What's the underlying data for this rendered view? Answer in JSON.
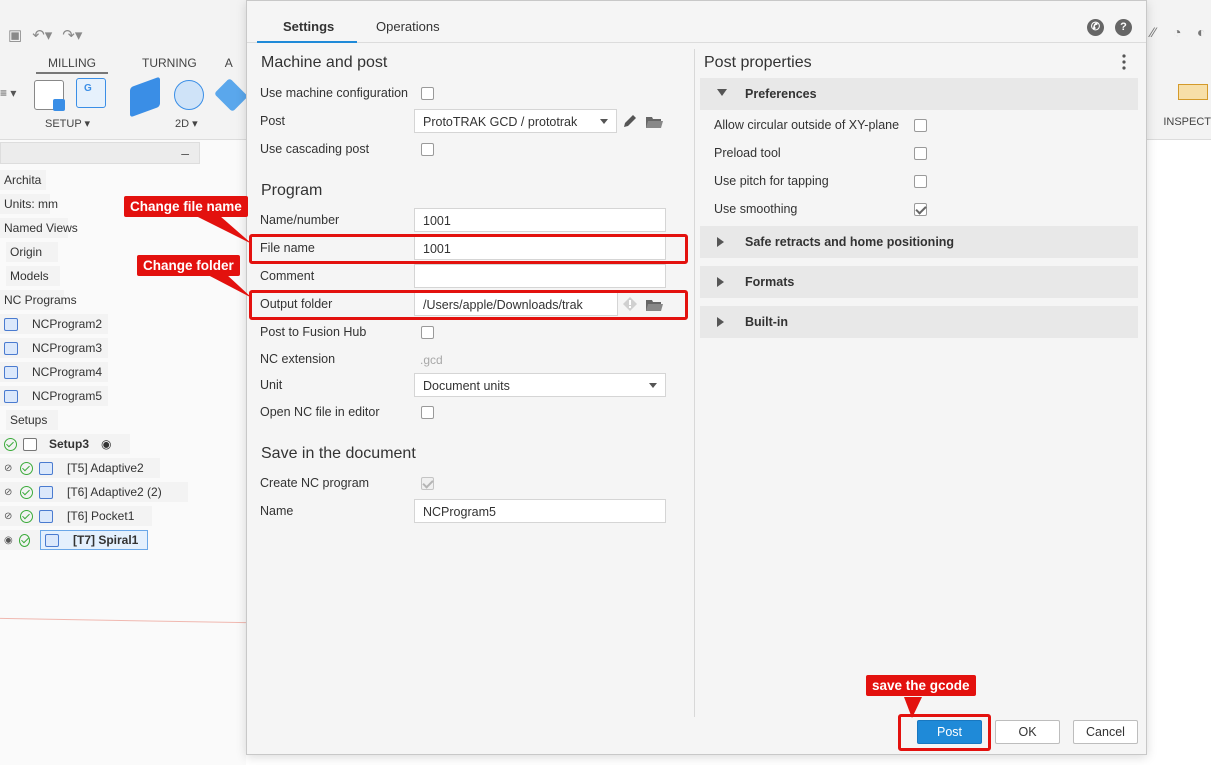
{
  "app": {
    "workspace_tabs": [
      "MILLING",
      "TURNING",
      "A"
    ],
    "setup_label": "SETUP ▾",
    "twod_label": "2D ▾",
    "inspect_label": "INSPECT"
  },
  "browser": {
    "rows": [
      "Archita",
      "Units: mm",
      "Named Views",
      "Origin",
      "Models",
      "NC Programs",
      "NCProgram2",
      "NCProgram3",
      "NCProgram4",
      "NCProgram5",
      "Setups",
      "Setup3",
      "[T5] Adaptive2",
      "[T6] Adaptive2 (2)",
      "[T6] Pocket1",
      "[T7] Spiral1"
    ]
  },
  "dialog": {
    "tabs": {
      "settings": "Settings",
      "operations": "Operations"
    },
    "machine_post": {
      "title": "Machine and post",
      "use_machine_config_label": "Use machine configuration",
      "post_label": "Post",
      "post_value": "ProtoTRAK GCD / prototrak",
      "use_cascading_label": "Use cascading post"
    },
    "program": {
      "title": "Program",
      "name_number_label": "Name/number",
      "name_number_value": "1001",
      "file_name_label": "File name",
      "file_name_value": "1001",
      "comment_label": "Comment",
      "comment_value": "",
      "output_folder_label": "Output folder",
      "output_folder_value": "/Users/apple/Downloads/trak",
      "post_to_hub_label": "Post to Fusion Hub",
      "nc_extension_label": "NC extension",
      "nc_extension_value": ".gcd",
      "unit_label": "Unit",
      "unit_value": "Document units",
      "open_nc_label": "Open NC file in editor"
    },
    "save_doc": {
      "title": "Save in the document",
      "create_nc_label": "Create NC program",
      "name_label": "Name",
      "name_value": "NCProgram5"
    },
    "post_properties": {
      "title": "Post properties",
      "preferences_label": "Preferences",
      "allow_circular_label": "Allow circular outside of XY-plane",
      "preload_tool_label": "Preload tool",
      "use_pitch_label": "Use pitch for tapping",
      "use_smoothing_label": "Use smoothing",
      "safe_retracts_label": "Safe retracts and home positioning",
      "formats_label": "Formats",
      "built_in_label": "Built-in"
    },
    "buttons": {
      "post": "Post",
      "ok": "OK",
      "cancel": "Cancel"
    },
    "checkboxes": {
      "use_machine_config": false,
      "use_cascading": false,
      "post_to_hub": false,
      "open_nc": false,
      "create_nc": true,
      "allow_circular": false,
      "preload_tool": false,
      "use_pitch": false,
      "use_smoothing": true
    }
  },
  "annotations": {
    "change_file_name": "Change file name",
    "change_folder": "Change folder",
    "save_gcode": "save the gcode"
  },
  "colors": {
    "accent": "#1f8ad8",
    "annotation_red": "#e3110e"
  }
}
